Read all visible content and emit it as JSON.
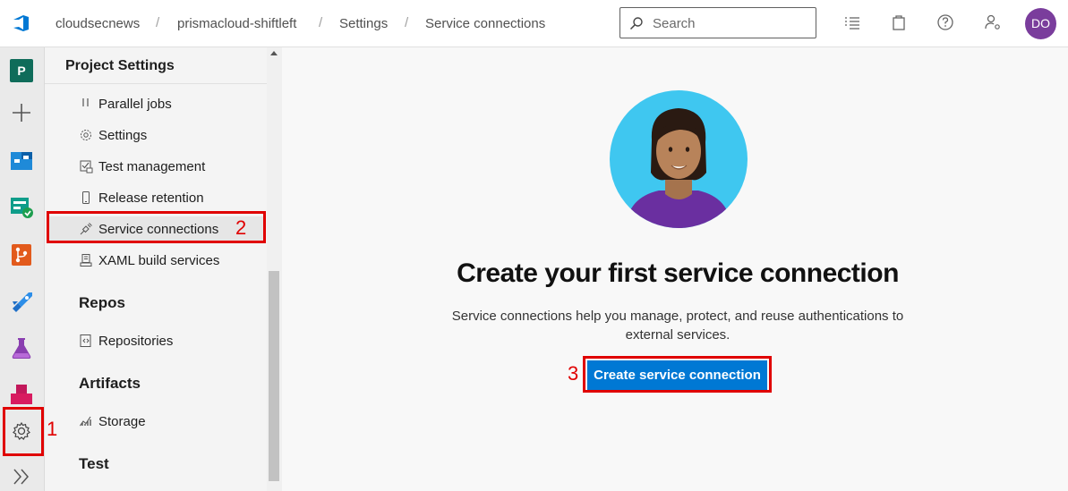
{
  "header": {
    "logo_icon": "azure-devops-logo",
    "breadcrumbs": [
      "cloudsecnews",
      "prismacloud-shiftleft",
      "Settings",
      "Service connections"
    ],
    "search_placeholder": "Search",
    "icons": [
      "checklist-icon",
      "shopping-bag-icon",
      "help-icon",
      "user-settings-icon"
    ],
    "avatar_initials": "DO",
    "avatar_color": "#7a3d9c"
  },
  "leftrail": {
    "project_badge": "P",
    "items": [
      "add-icon",
      "boards-icon",
      "pipelines-check-icon",
      "repos-icon",
      "pipelines-icon",
      "test-plans-icon",
      "artifacts-icon",
      "settings-gear-icon",
      "expand-icon"
    ]
  },
  "sidepanel": {
    "title": "Project Settings",
    "pipeline_items": [
      {
        "label": "Parallel jobs",
        "icon": "parallel-icon"
      },
      {
        "label": "Settings",
        "icon": "gear-icon"
      },
      {
        "label": "Test management",
        "icon": "test-management-icon"
      },
      {
        "label": "Release retention",
        "icon": "phone-icon"
      },
      {
        "label": "Service connections",
        "icon": "plug-icon"
      },
      {
        "label": "XAML build services",
        "icon": "build-icon"
      }
    ],
    "groups": {
      "repos": {
        "title": "Repos",
        "items": [
          {
            "label": "Repositories",
            "icon": "repository-icon"
          }
        ]
      },
      "artifacts": {
        "title": "Artifacts",
        "items": [
          {
            "label": "Storage",
            "icon": "storage-icon"
          }
        ]
      },
      "test": {
        "title": "Test"
      }
    }
  },
  "main": {
    "title": "Create your first service connection",
    "description": "Service connections help you manage, protect, and reuse authentications to external services.",
    "cta_label": "Create service connection"
  },
  "annotations": {
    "one": "1",
    "two": "2",
    "three": "3",
    "color": "#e00000"
  },
  "colors": {
    "accent": "#0078d4"
  }
}
